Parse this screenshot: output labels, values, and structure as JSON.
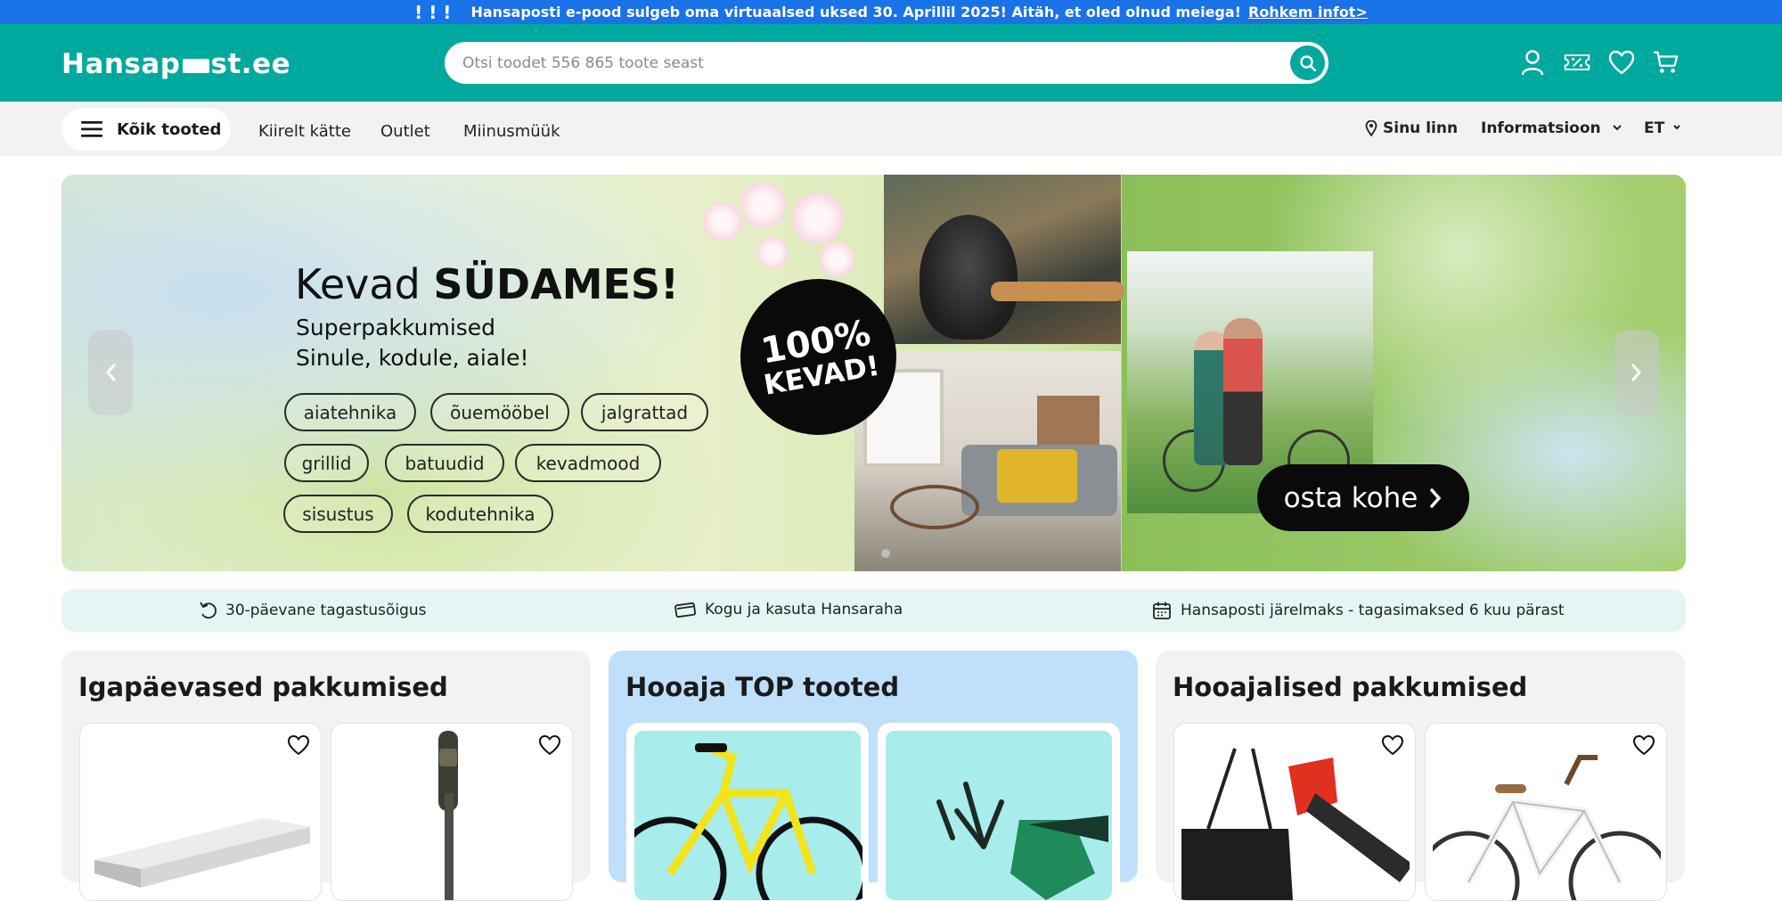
{
  "announcement": {
    "marks": "! ! !",
    "text": "Hansaposti e-pood sulgeb oma virtuaalsed uksed 30. Aprillil 2025! Aitäh, et oled olnud meiega!",
    "link": "Rohkem infot>"
  },
  "header": {
    "logo_left": "Hansap",
    "logo_right": "st.ee",
    "search_placeholder": "Otsi toodet 556 865 toote seast",
    "icons": [
      "user-icon",
      "discount-icon",
      "heart-icon",
      "cart-icon"
    ]
  },
  "nav": {
    "all_products": "Kõik tooted",
    "links": [
      "Kiirelt kätte",
      "Outlet",
      "Miinusmüük"
    ],
    "city": "Sinu linn",
    "info": "Informatsioon",
    "lang": "ET"
  },
  "hero": {
    "title_light": "Kevad",
    "title_bold": "SÜDAMES!",
    "sub_line1": "Superpakkumised",
    "sub_line2": "Sinule, kodule, aiale!",
    "pills": [
      "aiatehnika",
      "õuemööbel",
      "jalgrattad",
      "grillid",
      "batuudid",
      "kevadmood",
      "sisustus",
      "kodutehnika"
    ],
    "badge_line1": "100%",
    "badge_line2": "KEVAD!",
    "cta": "osta kohe"
  },
  "benefits": [
    {
      "icon": "return-icon",
      "text": "30-päevane tagastusõigus"
    },
    {
      "icon": "card-icon",
      "text": "Kogu ja kasuta Hansaraha"
    },
    {
      "icon": "calendar-icon",
      "text": "Hansaposti järelmaks - tagasimaksed 6 kuu pärast"
    }
  ],
  "panels": [
    {
      "title": "Igapäevased pakkumised"
    },
    {
      "title": "Hooaja TOP tooted"
    },
    {
      "title": "Hooajalised pakkumised"
    }
  ],
  "colors": {
    "announcement": "#1a72e8",
    "brand": "#00a99d",
    "nav_bg": "#f2f2f2",
    "benefits_bg": "#e5f5f3",
    "top_panel_bg": "#bfdffb"
  }
}
